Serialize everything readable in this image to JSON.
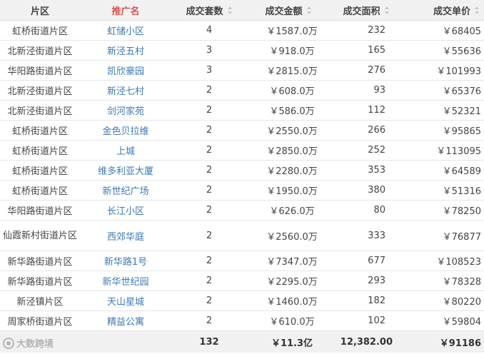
{
  "table": {
    "headers": {
      "area": "片区",
      "name": "推广名",
      "count": "成交套数",
      "amount": "成交金额",
      "floor_area": "成交面积",
      "unit_price": "成交单价"
    },
    "rows": [
      {
        "area": "虹桥街道片区",
        "name": "虹储小区",
        "count": "4",
        "amount": "￥1587.0万",
        "floor_area": "232",
        "unit_price": "￥68405"
      },
      {
        "area": "北新泾街道片区",
        "name": "新泾五村",
        "count": "3",
        "amount": "￥918.0万",
        "floor_area": "165",
        "unit_price": "￥55636"
      },
      {
        "area": "华阳路街道片区",
        "name": "凯欣豪园",
        "count": "3",
        "amount": "￥2815.0万",
        "floor_area": "276",
        "unit_price": "￥101993"
      },
      {
        "area": "北新泾街道片区",
        "name": "新泾七村",
        "count": "2",
        "amount": "￥608.0万",
        "floor_area": "93",
        "unit_price": "￥65376"
      },
      {
        "area": "北新泾街道片区",
        "name": "剑河家苑",
        "count": "2",
        "amount": "￥586.0万",
        "floor_area": "112",
        "unit_price": "￥52321"
      },
      {
        "area": "虹桥街道片区",
        "name": "金色贝拉维",
        "count": "2",
        "amount": "￥2550.0万",
        "floor_area": "266",
        "unit_price": "￥95865"
      },
      {
        "area": "虹桥街道片区",
        "name": "上城",
        "count": "2",
        "amount": "￥2850.0万",
        "floor_area": "252",
        "unit_price": "￥113095"
      },
      {
        "area": "虹桥街道片区",
        "name": "维多利亚大厦",
        "count": "2",
        "amount": "￥2280.0万",
        "floor_area": "353",
        "unit_price": "￥64589"
      },
      {
        "area": "虹桥街道片区",
        "name": "新世纪广场",
        "count": "2",
        "amount": "￥1950.0万",
        "floor_area": "380",
        "unit_price": "￥51316"
      },
      {
        "area": "华阳路街道片区",
        "name": "长江小区",
        "count": "2",
        "amount": "￥626.0万",
        "floor_area": "80",
        "unit_price": "￥78250"
      },
      {
        "area": "仙霞新村街道片区",
        "name": "西郊华庭",
        "count": "2",
        "amount": "￥2560.0万",
        "floor_area": "333",
        "unit_price": "￥76877",
        "tall": true
      },
      {
        "area": "新华路街道片区",
        "name": "新华路1号",
        "count": "2",
        "amount": "￥7347.0万",
        "floor_area": "677",
        "unit_price": "￥108523"
      },
      {
        "area": "新华路街道片区",
        "name": "新华世纪园",
        "count": "2",
        "amount": "￥2295.0万",
        "floor_area": "293",
        "unit_price": "￥78328"
      },
      {
        "area": "新泾镇片区",
        "name": "天山星城",
        "count": "2",
        "amount": "￥1460.0万",
        "floor_area": "182",
        "unit_price": "￥80220"
      },
      {
        "area": "周家桥街道片区",
        "name": "精益公寓",
        "count": "2",
        "amount": "￥610.0万",
        "floor_area": "102",
        "unit_price": "￥59804"
      }
    ],
    "totals": {
      "count": "132",
      "amount": "￥11.3亿",
      "floor_area": "12,382.00",
      "unit_price": "￥91186"
    }
  },
  "watermark": {
    "text": "大数跨境",
    "icon": "logo-icon"
  }
}
